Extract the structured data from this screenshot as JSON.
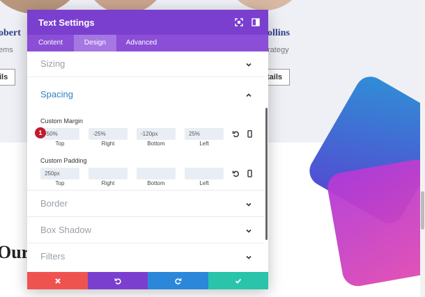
{
  "background": {
    "people": [
      {
        "name": "obert",
        "role": "ems",
        "button": "ils"
      },
      {
        "name": "ollins",
        "role": "rategy",
        "button": "tails"
      }
    ],
    "heading": "Our"
  },
  "modal": {
    "title": "Text Settings",
    "tabs": [
      "Content",
      "Design",
      "Advanced"
    ],
    "active_tab": "Design",
    "sections": {
      "sizing": "Sizing",
      "spacing": "Spacing",
      "border": "Border",
      "box_shadow": "Box Shadow",
      "filters": "Filters"
    },
    "custom_margin": {
      "label": "Custom Margin",
      "values": [
        "-50%",
        "-25%",
        "-120px",
        "25%"
      ],
      "sides": [
        "Top",
        "Right",
        "Bottom",
        "Left"
      ]
    },
    "custom_padding": {
      "label": "Custom Padding",
      "values": [
        "250px",
        "",
        "",
        ""
      ],
      "sides": [
        "Top",
        "Right",
        "Bottom",
        "Left"
      ]
    },
    "badge": "1",
    "footer": [
      "cancel",
      "undo",
      "redo",
      "save"
    ]
  },
  "colors": {
    "header": "#7b3fcf",
    "tabs": "#8b4ed6",
    "accent": "#2e82c5",
    "cancel": "#ef5350",
    "undo": "#7b3fcf",
    "redo": "#2b87da",
    "save": "#29c4a9"
  }
}
